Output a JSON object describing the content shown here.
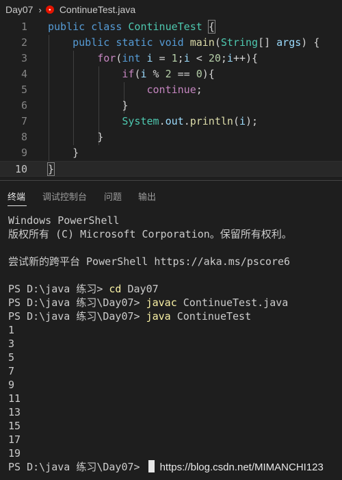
{
  "breadcrumb": {
    "folder": "Day07",
    "file": "ContinueTest.java",
    "error_icon_label": "•"
  },
  "editor": {
    "lines": [
      {
        "n": "1",
        "tokens": [
          [
            "kw",
            "public"
          ],
          [
            "",
            " "
          ],
          [
            "kw",
            "class"
          ],
          [
            "",
            " "
          ],
          [
            "ty",
            "ContinueTest"
          ],
          [
            "",
            " "
          ],
          [
            "brm",
            "{"
          ]
        ]
      },
      {
        "n": "2",
        "tokens": [
          [
            "",
            "    "
          ],
          [
            "kw",
            "public"
          ],
          [
            "",
            " "
          ],
          [
            "kw",
            "static"
          ],
          [
            "",
            " "
          ],
          [
            "kw",
            "void"
          ],
          [
            "",
            " "
          ],
          [
            "fn",
            "main"
          ],
          [
            "",
            "("
          ],
          [
            "ty",
            "String"
          ],
          [
            "",
            "[] "
          ],
          [
            "var",
            "args"
          ],
          [
            "",
            ") {"
          ]
        ]
      },
      {
        "n": "3",
        "tokens": [
          [
            "",
            "        "
          ],
          [
            "kw2",
            "for"
          ],
          [
            "",
            "("
          ],
          [
            "kw",
            "int"
          ],
          [
            "",
            " "
          ],
          [
            "var",
            "i"
          ],
          [
            "",
            " = "
          ],
          [
            "num",
            "1"
          ],
          [
            "",
            ";"
          ],
          [
            "var",
            "i"
          ],
          [
            "",
            " < "
          ],
          [
            "num",
            "20"
          ],
          [
            "",
            ";"
          ],
          [
            "var",
            "i"
          ],
          [
            "",
            "++){"
          ]
        ]
      },
      {
        "n": "4",
        "tokens": [
          [
            "",
            "            "
          ],
          [
            "kw2",
            "if"
          ],
          [
            "",
            "("
          ],
          [
            "var",
            "i"
          ],
          [
            "",
            " % "
          ],
          [
            "num",
            "2"
          ],
          [
            "",
            " == "
          ],
          [
            "num",
            "0"
          ],
          [
            "",
            "){"
          ]
        ]
      },
      {
        "n": "5",
        "tokens": [
          [
            "",
            "                "
          ],
          [
            "kw2",
            "continue"
          ],
          [
            "",
            ";"
          ]
        ]
      },
      {
        "n": "6",
        "tokens": [
          [
            "",
            "            }"
          ]
        ]
      },
      {
        "n": "7",
        "tokens": [
          [
            "",
            "            "
          ],
          [
            "ty",
            "System"
          ],
          [
            "",
            "."
          ],
          [
            "var",
            "out"
          ],
          [
            "",
            "."
          ],
          [
            "fn",
            "println"
          ],
          [
            "",
            "("
          ],
          [
            "var",
            "i"
          ],
          [
            "",
            ");"
          ]
        ]
      },
      {
        "n": "8",
        "tokens": [
          [
            "",
            "        }"
          ]
        ]
      },
      {
        "n": "9",
        "tokens": [
          [
            "",
            "    }"
          ]
        ]
      },
      {
        "n": "10",
        "tokens": [
          [
            "brm",
            "}"
          ]
        ]
      }
    ]
  },
  "panel": {
    "tabs": [
      "终端",
      "调试控制台",
      "问题",
      "输出"
    ],
    "active_tab": 0
  },
  "terminal": {
    "header1": "Windows PowerShell",
    "header2": "版权所有 (C) Microsoft Corporation。保留所有权利。",
    "header3": "尝试新的跨平台 PowerShell https://aka.ms/pscore6",
    "cmd1_prompt": "PS D:\\java 练习> ",
    "cmd1_cmd": "cd",
    "cmd1_arg": " Day07",
    "cmd2_prompt": "PS D:\\java 练习\\Day07> ",
    "cmd2_cmd": "javac",
    "cmd2_arg": " ContinueTest.java",
    "cmd3_prompt": "PS D:\\java 练习\\Day07> ",
    "cmd3_cmd": "java",
    "cmd3_arg": " ContinueTest",
    "output": [
      "1",
      "3",
      "5",
      "7",
      "9",
      "11",
      "13",
      "15",
      "17",
      "19"
    ],
    "final_prompt": "PS D:\\java 练习\\Day07> ",
    "watermark": "https://blog.csdn.net/MIMANCHI123"
  },
  "colors": {
    "background": "#1e1e1e",
    "keyword": "#569cd6",
    "control": "#c586c0",
    "type": "#4ec9b0",
    "function": "#dcdcaa",
    "number": "#b5cea8",
    "variable": "#9cdcfe",
    "command": "#f9f1a5",
    "error_icon": "#e51400"
  }
}
